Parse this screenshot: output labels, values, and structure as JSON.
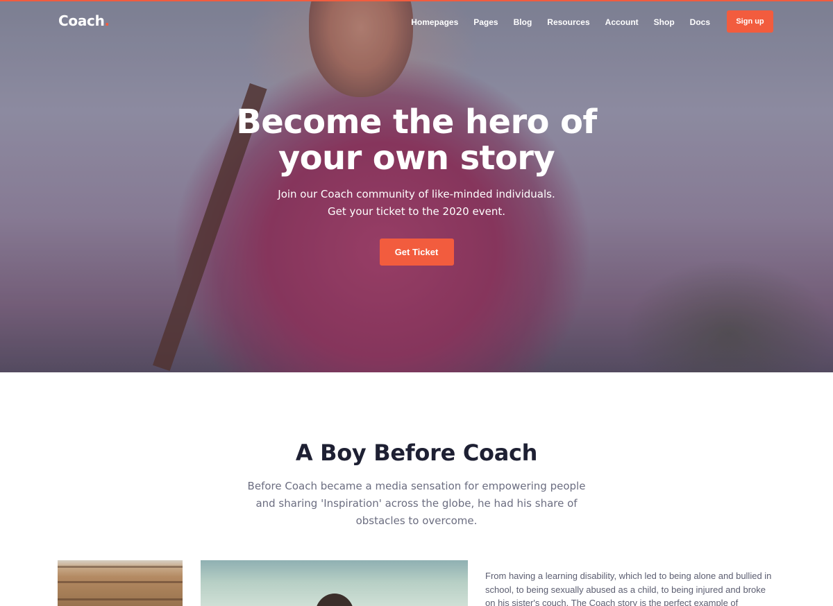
{
  "nav": {
    "logo": "Coach",
    "logo_dot": ".",
    "links": [
      "Homepages",
      "Pages",
      "Blog",
      "Resources",
      "Account",
      "Shop",
      "Docs"
    ],
    "signup_label": "Sign up"
  },
  "hero": {
    "title": "Become the hero of your own story",
    "subtitle_line1": "Join our Coach community of like-minded individuals.",
    "subtitle_line2": "Get your ticket to the 2020 event.",
    "cta_label": "Get Ticket"
  },
  "story": {
    "title": "A Boy Before Coach",
    "lead": "Before Coach became a media sensation for empowering people and sharing 'Inspiration' across the globe, he had his share of obstacles to overcome.",
    "body": "From having a learning disability, which led to being alone and bullied in school, to being sexually abused as a child, to being injured and broke on his sister's couch. The Coach story is the perfect example of"
  },
  "colors": {
    "accent": "#f25c3e",
    "heading": "#1e2033",
    "muted": "#6b6d80"
  }
}
